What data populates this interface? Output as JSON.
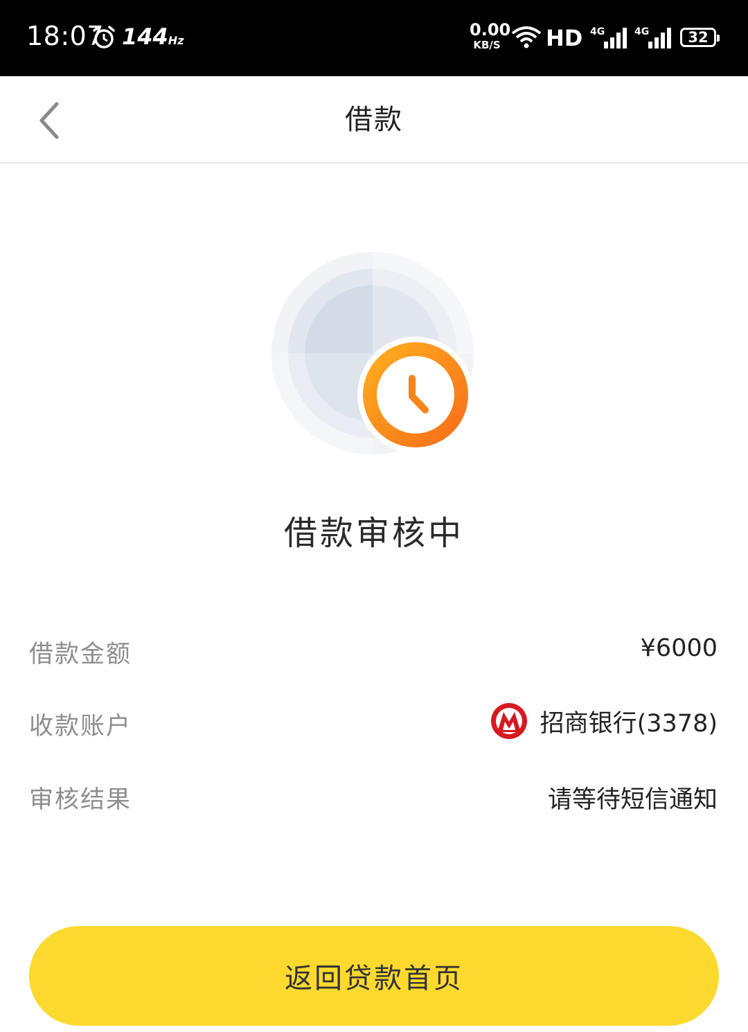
{
  "status_bar": {
    "time": "18:07",
    "refresh_rate": "144",
    "refresh_unit": "Hz",
    "net_speed": "0.00",
    "net_unit": "KB/S",
    "hd_label": "HD",
    "battery": "32"
  },
  "nav": {
    "title": "借款"
  },
  "status": {
    "title": "借款审核中",
    "icon": "clock-icon"
  },
  "details": {
    "amount_label": "借款金额",
    "amount_value": "¥6000",
    "account_label": "收款账户",
    "account_value": "招商银行(3378)",
    "account_icon": "cmb-bank-logo",
    "result_label": "审核结果",
    "result_value": "请等待短信通知"
  },
  "actions": {
    "home_label": "返回贷款首页"
  },
  "colors": {
    "accent": "#fcd92e",
    "clock_orange": "#f7851c",
    "bank_red": "#d71920"
  }
}
